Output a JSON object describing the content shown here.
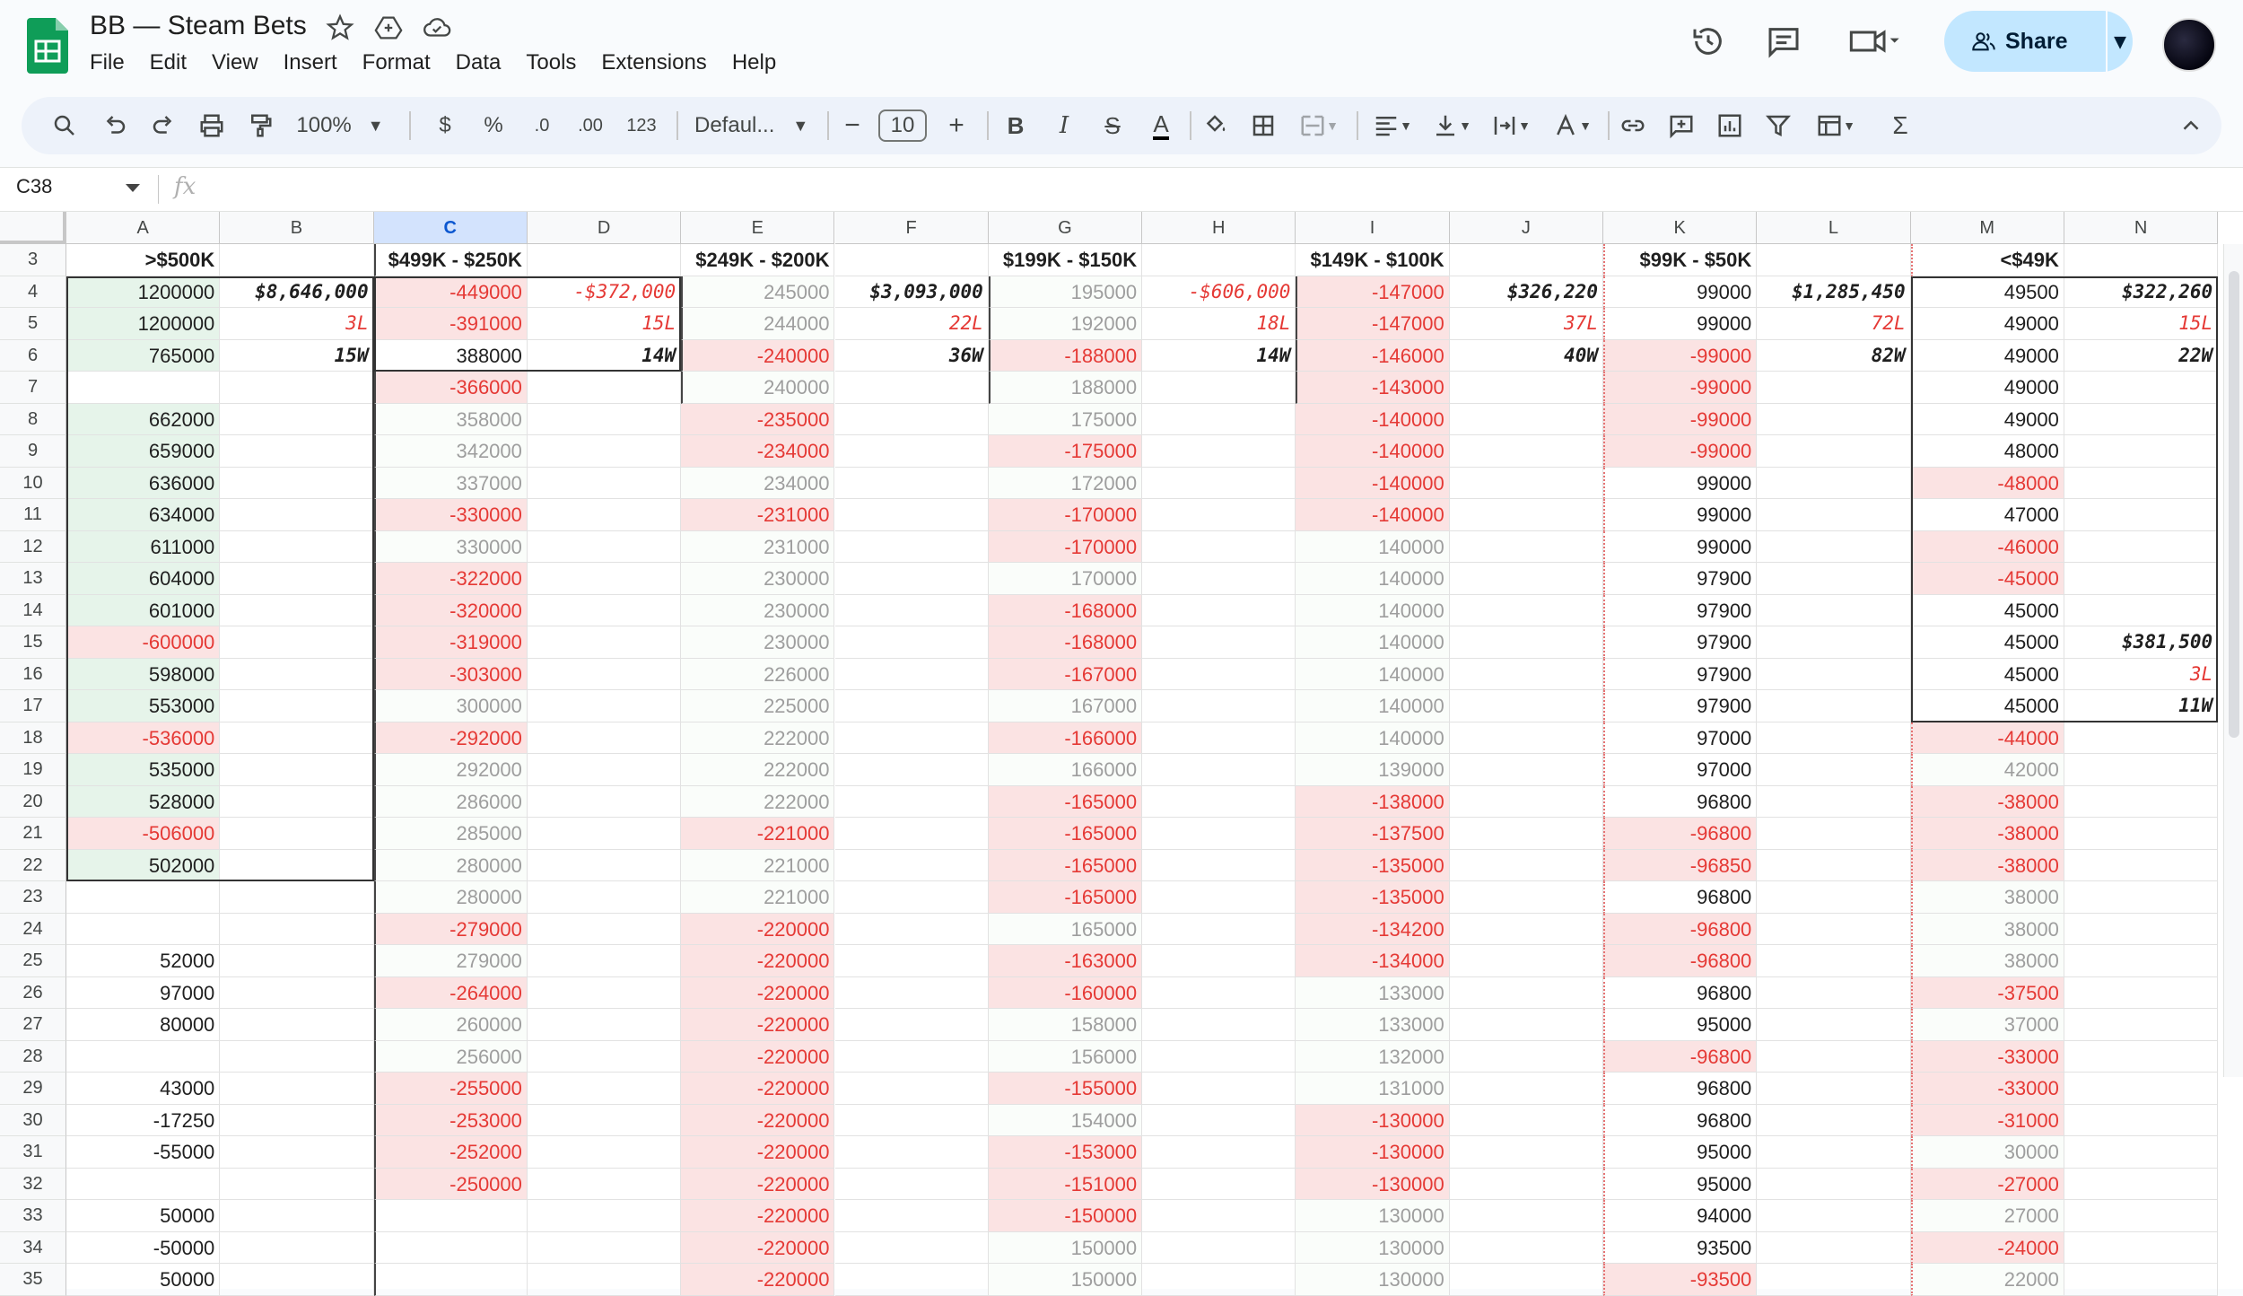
{
  "app": {
    "doc_title": "BB — Steam Bets",
    "menu": [
      "File",
      "Edit",
      "View",
      "Insert",
      "Format",
      "Data",
      "Tools",
      "Extensions",
      "Help"
    ],
    "share_label": "Share",
    "zoom": "100%",
    "currency_btn": "$",
    "percent_btn": "%",
    "decrease_decimal": ".0",
    "increase_decimal": ".00",
    "number_format": "123",
    "font_name": "Defaul...",
    "font_size": "10",
    "name_box": "C38",
    "fx_label": "fx"
  },
  "colors": {
    "red_text": "#e53935",
    "gray_text": "#9e9e9e",
    "green_fill": "#e6f4ea",
    "pink_fill": "#fbe3e3",
    "light_pink_fill": "#fdf2f2",
    "selected_col": "#d3e3fd"
  },
  "columns": [
    "A",
    "B",
    "C",
    "D",
    "E",
    "F",
    "G",
    "H",
    "I",
    "J",
    "K",
    "L",
    "M",
    "N"
  ],
  "rows": [
    {
      "n": "3",
      "cells": {
        "A": [
          ">$500K",
          "h"
        ],
        "C": [
          "$499K - $250K",
          "h"
        ],
        "E": [
          "$249K - $200K",
          "h"
        ],
        "G": [
          "$199K - $150K",
          "h"
        ],
        "I": [
          "$149K - $100K",
          "h"
        ],
        "K": [
          "$99K - $50K",
          "h"
        ],
        "M": [
          "<$49K",
          "h"
        ]
      }
    },
    {
      "n": "4",
      "cells": {
        "A": [
          "1200000",
          "g"
        ],
        "B": [
          "$8,646,000",
          "ib"
        ],
        "C": [
          "-449000",
          "rp"
        ],
        "D": [
          "-$372,000",
          "ir"
        ],
        "E": [
          "245000",
          "gray"
        ],
        "F": [
          "$3,093,000",
          "ib"
        ],
        "G": [
          "195000",
          "gray"
        ],
        "H": [
          "-$606,000",
          "ir"
        ],
        "I": [
          "-147000",
          "rp"
        ],
        "J": [
          "$326,220",
          "ib"
        ],
        "K": [
          "99000",
          "n"
        ],
        "L": [
          "$1,285,450",
          "ib"
        ],
        "M": [
          "49500",
          "n"
        ],
        "N": [
          "$322,260",
          "ib"
        ]
      }
    },
    {
      "n": "5",
      "cells": {
        "A": [
          "1200000",
          "g"
        ],
        "B": [
          "3L",
          "ir"
        ],
        "C": [
          "-391000",
          "rp"
        ],
        "D": [
          "15L",
          "ir"
        ],
        "E": [
          "244000",
          "gray"
        ],
        "F": [
          "22L",
          "ir"
        ],
        "G": [
          "192000",
          "gray"
        ],
        "H": [
          "18L",
          "ir"
        ],
        "I": [
          "-147000",
          "rp"
        ],
        "J": [
          "37L",
          "ir"
        ],
        "K": [
          "99000",
          "n"
        ],
        "L": [
          "72L",
          "ir"
        ],
        "M": [
          "49000",
          "n"
        ],
        "N": [
          "15L",
          "ir"
        ]
      }
    },
    {
      "n": "6",
      "cells": {
        "A": [
          "765000",
          "g"
        ],
        "B": [
          "15W",
          "ib"
        ],
        "C": [
          "388000",
          "n"
        ],
        "D": [
          "14W",
          "ib"
        ],
        "E": [
          "-240000",
          "rp"
        ],
        "F": [
          "36W",
          "ib"
        ],
        "G": [
          "-188000",
          "rp"
        ],
        "H": [
          "14W",
          "ib"
        ],
        "I": [
          "-146000",
          "rp"
        ],
        "J": [
          "40W",
          "ib"
        ],
        "K": [
          "-99000",
          "rp"
        ],
        "L": [
          "82W",
          "ib"
        ],
        "M": [
          "49000",
          "n"
        ],
        "N": [
          "22W",
          "ib"
        ]
      }
    },
    {
      "n": "7",
      "cells": {
        "C": [
          "-366000",
          "rp"
        ],
        "E": [
          "240000",
          "gray"
        ],
        "G": [
          "188000",
          "gray"
        ],
        "I": [
          "-143000",
          "rp"
        ],
        "K": [
          "-99000",
          "rp"
        ],
        "M": [
          "49000",
          "n"
        ]
      }
    },
    {
      "n": "8",
      "cells": {
        "A": [
          "662000",
          "g"
        ],
        "C": [
          "358000",
          "gray"
        ],
        "E": [
          "-235000",
          "rp"
        ],
        "G": [
          "175000",
          "gray"
        ],
        "I": [
          "-140000",
          "rp"
        ],
        "K": [
          "-99000",
          "rp"
        ],
        "M": [
          "49000",
          "n"
        ]
      }
    },
    {
      "n": "9",
      "cells": {
        "A": [
          "659000",
          "g"
        ],
        "C": [
          "342000",
          "gray"
        ],
        "E": [
          "-234000",
          "rp"
        ],
        "G": [
          "-175000",
          "rp"
        ],
        "I": [
          "-140000",
          "rp"
        ],
        "K": [
          "-99000",
          "rp"
        ],
        "M": [
          "48000",
          "n"
        ]
      }
    },
    {
      "n": "10",
      "cells": {
        "A": [
          "636000",
          "g"
        ],
        "C": [
          "337000",
          "gray"
        ],
        "E": [
          "234000",
          "gray"
        ],
        "G": [
          "172000",
          "gray"
        ],
        "I": [
          "-140000",
          "rp"
        ],
        "K": [
          "99000",
          "n"
        ],
        "M": [
          "-48000",
          "rp"
        ]
      }
    },
    {
      "n": "11",
      "cells": {
        "A": [
          "634000",
          "g"
        ],
        "C": [
          "-330000",
          "rp"
        ],
        "E": [
          "-231000",
          "rp"
        ],
        "G": [
          "-170000",
          "rp"
        ],
        "I": [
          "-140000",
          "rp"
        ],
        "K": [
          "99000",
          "n"
        ],
        "M": [
          "47000",
          "n"
        ]
      }
    },
    {
      "n": "12",
      "cells": {
        "A": [
          "611000",
          "g"
        ],
        "C": [
          "330000",
          "gray"
        ],
        "E": [
          "231000",
          "gray"
        ],
        "G": [
          "-170000",
          "rp"
        ],
        "I": [
          "140000",
          "gray"
        ],
        "K": [
          "99000",
          "n"
        ],
        "M": [
          "-46000",
          "rp"
        ]
      }
    },
    {
      "n": "13",
      "cells": {
        "A": [
          "604000",
          "g"
        ],
        "C": [
          "-322000",
          "rp"
        ],
        "E": [
          "230000",
          "gray"
        ],
        "G": [
          "170000",
          "gray"
        ],
        "I": [
          "140000",
          "gray"
        ],
        "K": [
          "97900",
          "n"
        ],
        "M": [
          "-45000",
          "rp"
        ]
      }
    },
    {
      "n": "14",
      "cells": {
        "A": [
          "601000",
          "g"
        ],
        "C": [
          "-320000",
          "rp"
        ],
        "E": [
          "230000",
          "gray"
        ],
        "G": [
          "-168000",
          "rp"
        ],
        "I": [
          "140000",
          "gray"
        ],
        "K": [
          "97900",
          "n"
        ],
        "M": [
          "45000",
          "n"
        ]
      }
    },
    {
      "n": "15",
      "cells": {
        "A": [
          "-600000",
          "rp"
        ],
        "C": [
          "-319000",
          "rp"
        ],
        "E": [
          "230000",
          "gray"
        ],
        "G": [
          "-168000",
          "rp"
        ],
        "I": [
          "140000",
          "gray"
        ],
        "K": [
          "97900",
          "n"
        ],
        "M": [
          "45000",
          "n"
        ],
        "N": [
          "$381,500",
          "ib"
        ]
      }
    },
    {
      "n": "16",
      "cells": {
        "A": [
          "598000",
          "g"
        ],
        "C": [
          "-303000",
          "rp"
        ],
        "E": [
          "226000",
          "gray"
        ],
        "G": [
          "-167000",
          "rp"
        ],
        "I": [
          "140000",
          "gray"
        ],
        "K": [
          "97900",
          "n"
        ],
        "M": [
          "45000",
          "n"
        ],
        "N": [
          "3L",
          "ir"
        ]
      }
    },
    {
      "n": "17",
      "cells": {
        "A": [
          "553000",
          "g"
        ],
        "C": [
          "300000",
          "gray"
        ],
        "E": [
          "225000",
          "gray"
        ],
        "G": [
          "167000",
          "gray"
        ],
        "I": [
          "140000",
          "gray"
        ],
        "K": [
          "97900",
          "n"
        ],
        "M": [
          "45000",
          "n"
        ],
        "N": [
          "11W",
          "ib"
        ]
      }
    },
    {
      "n": "18",
      "cells": {
        "A": [
          "-536000",
          "rp"
        ],
        "C": [
          "-292000",
          "rp"
        ],
        "E": [
          "222000",
          "gray"
        ],
        "G": [
          "-166000",
          "rp"
        ],
        "I": [
          "140000",
          "gray"
        ],
        "K": [
          "97000",
          "n"
        ],
        "M": [
          "-44000",
          "rp"
        ]
      }
    },
    {
      "n": "19",
      "cells": {
        "A": [
          "535000",
          "g"
        ],
        "C": [
          "292000",
          "gray"
        ],
        "E": [
          "222000",
          "gray"
        ],
        "G": [
          "166000",
          "gray"
        ],
        "I": [
          "139000",
          "gray"
        ],
        "K": [
          "97000",
          "n"
        ],
        "M": [
          "42000",
          "gray"
        ]
      }
    },
    {
      "n": "20",
      "cells": {
        "A": [
          "528000",
          "g"
        ],
        "C": [
          "286000",
          "gray"
        ],
        "E": [
          "222000",
          "gray"
        ],
        "G": [
          "-165000",
          "rp"
        ],
        "I": [
          "-138000",
          "rp"
        ],
        "K": [
          "96800",
          "n"
        ],
        "M": [
          "-38000",
          "rp"
        ]
      }
    },
    {
      "n": "21",
      "cells": {
        "A": [
          "-506000",
          "rp"
        ],
        "C": [
          "285000",
          "gray"
        ],
        "E": [
          "-221000",
          "rp"
        ],
        "G": [
          "-165000",
          "rp"
        ],
        "I": [
          "-137500",
          "rp"
        ],
        "K": [
          "-96800",
          "rp"
        ],
        "M": [
          "-38000",
          "rp"
        ]
      }
    },
    {
      "n": "22",
      "cells": {
        "A": [
          "502000",
          "g"
        ],
        "C": [
          "280000",
          "gray"
        ],
        "E": [
          "221000",
          "gray"
        ],
        "G": [
          "-165000",
          "rp"
        ],
        "I": [
          "-135000",
          "rp"
        ],
        "K": [
          "-96850",
          "rp"
        ],
        "M": [
          "-38000",
          "rp"
        ]
      }
    },
    {
      "n": "23",
      "cells": {
        "C": [
          "280000",
          "gray"
        ],
        "E": [
          "221000",
          "gray"
        ],
        "G": [
          "-165000",
          "rp"
        ],
        "I": [
          "-135000",
          "rp"
        ],
        "K": [
          "96800",
          "n"
        ],
        "M": [
          "38000",
          "gray"
        ]
      }
    },
    {
      "n": "24",
      "cells": {
        "C": [
          "-279000",
          "rp"
        ],
        "E": [
          "-220000",
          "rp"
        ],
        "G": [
          "165000",
          "gray"
        ],
        "I": [
          "-134200",
          "rp"
        ],
        "K": [
          "-96800",
          "rp"
        ],
        "M": [
          "38000",
          "gray"
        ]
      }
    },
    {
      "n": "25",
      "cells": {
        "A": [
          "52000",
          "n"
        ],
        "C": [
          "279000",
          "gray"
        ],
        "E": [
          "-220000",
          "rp"
        ],
        "G": [
          "-163000",
          "rp"
        ],
        "I": [
          "-134000",
          "rp"
        ],
        "K": [
          "-96800",
          "rp"
        ],
        "M": [
          "38000",
          "gray"
        ]
      }
    },
    {
      "n": "26",
      "cells": {
        "A": [
          "97000",
          "n"
        ],
        "C": [
          "-264000",
          "rp"
        ],
        "E": [
          "-220000",
          "rp"
        ],
        "G": [
          "-160000",
          "rp"
        ],
        "I": [
          "133000",
          "gray"
        ],
        "K": [
          "96800",
          "n"
        ],
        "M": [
          "-37500",
          "rp"
        ]
      }
    },
    {
      "n": "27",
      "cells": {
        "A": [
          "80000",
          "n"
        ],
        "C": [
          "260000",
          "gray"
        ],
        "E": [
          "-220000",
          "rp"
        ],
        "G": [
          "158000",
          "gray"
        ],
        "I": [
          "133000",
          "gray"
        ],
        "K": [
          "95000",
          "n"
        ],
        "M": [
          "37000",
          "gray"
        ]
      }
    },
    {
      "n": "28",
      "cells": {
        "C": [
          "256000",
          "gray"
        ],
        "E": [
          "-220000",
          "rp"
        ],
        "G": [
          "156000",
          "gray"
        ],
        "I": [
          "132000",
          "gray"
        ],
        "K": [
          "-96800",
          "rp"
        ],
        "M": [
          "-33000",
          "rp"
        ]
      }
    },
    {
      "n": "29",
      "cells": {
        "A": [
          "43000",
          "n"
        ],
        "C": [
          "-255000",
          "rp"
        ],
        "E": [
          "-220000",
          "rp"
        ],
        "G": [
          "-155000",
          "rp"
        ],
        "I": [
          "131000",
          "gray"
        ],
        "K": [
          "96800",
          "n"
        ],
        "M": [
          "-33000",
          "rp"
        ]
      }
    },
    {
      "n": "30",
      "cells": {
        "A": [
          "-17250",
          "n"
        ],
        "C": [
          "-253000",
          "rp"
        ],
        "E": [
          "-220000",
          "rp"
        ],
        "G": [
          "154000",
          "gray"
        ],
        "I": [
          "-130000",
          "rp"
        ],
        "K": [
          "96800",
          "n"
        ],
        "M": [
          "-31000",
          "rp"
        ]
      }
    },
    {
      "n": "31",
      "cells": {
        "A": [
          "-55000",
          "n"
        ],
        "C": [
          "-252000",
          "rp"
        ],
        "E": [
          "-220000",
          "rp"
        ],
        "G": [
          "-153000",
          "rp"
        ],
        "I": [
          "-130000",
          "rp"
        ],
        "K": [
          "95000",
          "n"
        ],
        "M": [
          "30000",
          "gray"
        ]
      }
    },
    {
      "n": "32",
      "cells": {
        "C": [
          "-250000",
          "rp"
        ],
        "E": [
          "-220000",
          "rp"
        ],
        "G": [
          "-151000",
          "rp"
        ],
        "I": [
          "-130000",
          "rp"
        ],
        "K": [
          "95000",
          "n"
        ],
        "M": [
          "-27000",
          "rp"
        ]
      }
    },
    {
      "n": "33",
      "cells": {
        "A": [
          "50000",
          "n"
        ],
        "E": [
          "-220000",
          "rp"
        ],
        "G": [
          "-150000",
          "rp"
        ],
        "I": [
          "130000",
          "gray"
        ],
        "K": [
          "94000",
          "n"
        ],
        "M": [
          "27000",
          "gray"
        ]
      }
    },
    {
      "n": "34",
      "cells": {
        "A": [
          "-50000",
          "n"
        ],
        "E": [
          "-220000",
          "rp"
        ],
        "G": [
          "150000",
          "gray"
        ],
        "I": [
          "130000",
          "gray"
        ],
        "K": [
          "93500",
          "n"
        ],
        "M": [
          "-24000",
          "rp"
        ]
      }
    },
    {
      "n": "35",
      "cells": {
        "A": [
          "50000",
          "n"
        ],
        "E": [
          "-220000",
          "rp"
        ],
        "G": [
          "150000",
          "gray"
        ],
        "I": [
          "130000",
          "gray"
        ],
        "K": [
          "-93500",
          "rp"
        ],
        "M": [
          "22000",
          "gray"
        ]
      }
    }
  ]
}
